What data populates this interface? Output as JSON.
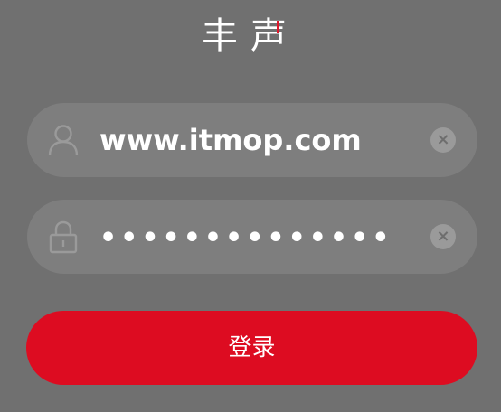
{
  "app": {
    "logo_text": "丰声"
  },
  "colors": {
    "background": "#707070",
    "field_background": "#7e7e7e",
    "accent": "#dd0c21"
  },
  "form": {
    "username": {
      "icon": "user-icon",
      "value": "www.itmop.com"
    },
    "password": {
      "icon": "lock-icon",
      "value": "••••••••••••••"
    },
    "clear_icon": "clear-icon",
    "clear_glyph": "×",
    "login_label": "登录"
  }
}
